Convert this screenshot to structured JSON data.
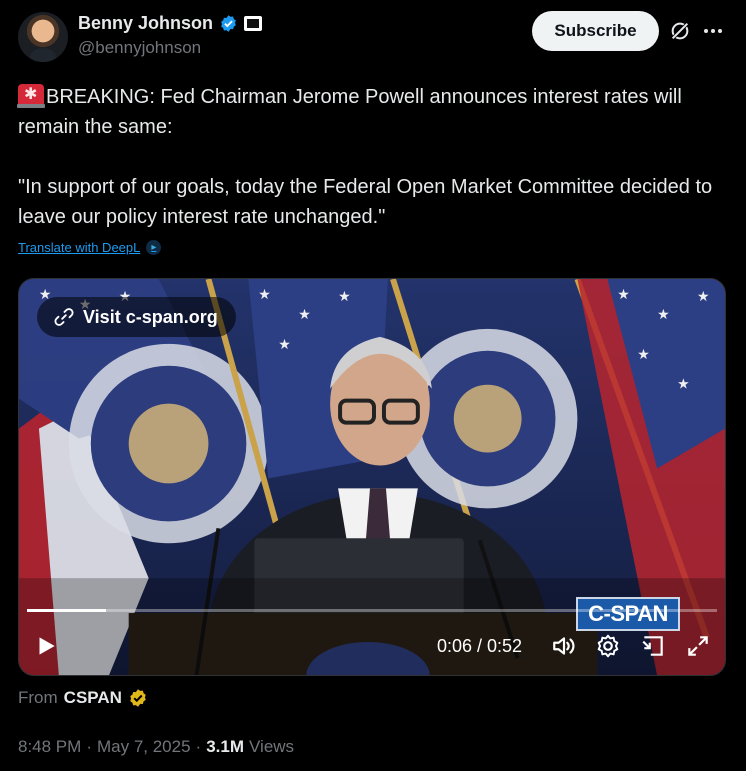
{
  "author": {
    "display_name": "Benny Johnson",
    "handle": "@bennyjohnson",
    "verified_color": "#1d9bf0"
  },
  "header": {
    "subscribe_label": "Subscribe"
  },
  "tweet": {
    "line1": "BREAKING: Fed Chairman Jerome Powell announces interest rates will remain the same:",
    "line2": "\"In support of our goals, today the Federal Open Market Committee decided to leave our policy interest rate unchanged.\"",
    "leading_icon": "rotating-light-emoji"
  },
  "translate": {
    "label": "Translate with DeepL"
  },
  "video": {
    "visit_label": "Visit c-span.org",
    "watermark": "C-SPAN",
    "current_time": "0:06",
    "duration": "0:52",
    "time_display": "0:06 / 0:52",
    "progress_fraction": 0.115
  },
  "source": {
    "prefix": "From",
    "name": "CSPAN",
    "badge_color": "#e2b719"
  },
  "meta": {
    "time": "8:48 PM",
    "separator": "·",
    "date": "May 7, 2025",
    "views_count": "3.1M",
    "views_label": "Views"
  },
  "colors": {
    "background": "#000000",
    "text_primary": "#e7e9ea",
    "text_secondary": "#71767b",
    "link": "#1d9bf0"
  }
}
